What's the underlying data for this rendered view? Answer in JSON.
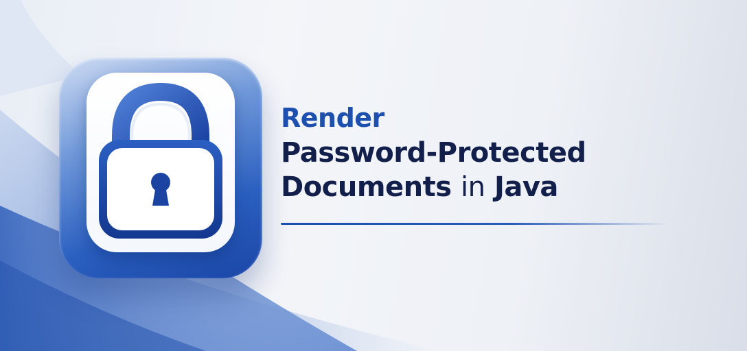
{
  "headline": {
    "line1": "Render",
    "line2": "Password-Protected",
    "line3_main": "Documents",
    "line3_connector": "in",
    "line3_end": "Java"
  },
  "icon": {
    "name": "padlock-icon"
  },
  "colors": {
    "accent": "#1c4fae",
    "title_text": "#121f4a",
    "tile_dark": "#1b46a6",
    "tile_light": "#cfdcf3"
  }
}
